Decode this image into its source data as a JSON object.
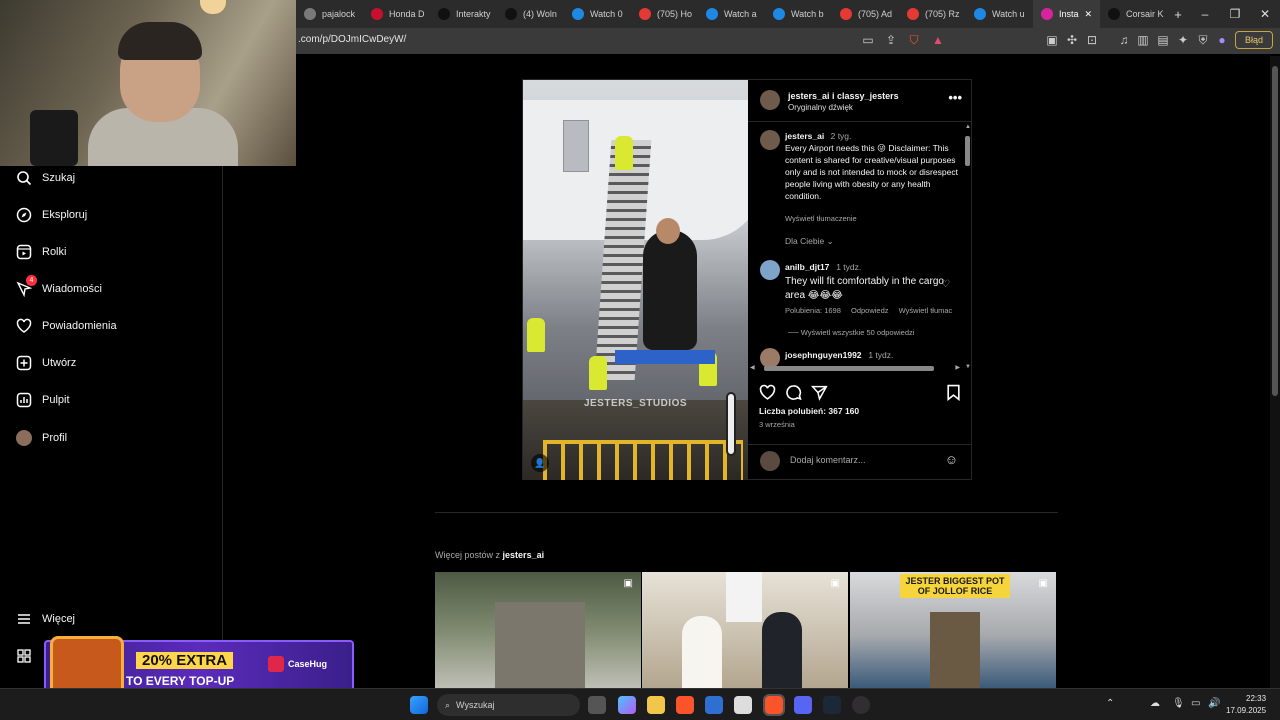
{
  "browser": {
    "tabs": [
      {
        "label": "pajalock",
        "color": "#7a7a7a"
      },
      {
        "label": "Honda D",
        "color": "#c8102e"
      },
      {
        "label": "Interakty",
        "color": "#111111"
      },
      {
        "label": "(4) Woln",
        "color": "#111111"
      },
      {
        "label": "Watch 0",
        "color": "#1e88e5"
      },
      {
        "label": "(705) Ho",
        "color": "#e53935"
      },
      {
        "label": "Watch a",
        "color": "#1e88e5"
      },
      {
        "label": "Watch b",
        "color": "#1e88e5"
      },
      {
        "label": "(705) Ad",
        "color": "#e53935"
      },
      {
        "label": "(705) Rz",
        "color": "#e53935"
      },
      {
        "label": "Watch u",
        "color": "#1e88e5"
      },
      {
        "label": "Insta",
        "color": "#d6249f",
        "active": true
      },
      {
        "label": "Corsair K",
        "color": "#111111"
      }
    ],
    "url": ".com/p/DOJmICwDeyW/",
    "error_label": "Błąd"
  },
  "sidebar": {
    "items": [
      {
        "label": "Szukaj",
        "icon": "search-icon"
      },
      {
        "label": "Eksploruj",
        "icon": "compass-icon"
      },
      {
        "label": "Rolki",
        "icon": "reels-icon"
      },
      {
        "label": "Wiadomości",
        "icon": "messenger-icon",
        "badge": "4"
      },
      {
        "label": "Powiadomienia",
        "icon": "heart-icon"
      },
      {
        "label": "Utwórz",
        "icon": "plus-square-icon"
      },
      {
        "label": "Pulpit",
        "icon": "dashboard-icon"
      },
      {
        "label": "Profil",
        "icon": "avatar"
      }
    ],
    "more": "Więcej"
  },
  "post": {
    "header": {
      "authors": "jesters_ai i classy_jesters",
      "audio": "Oryginalny dźwięk"
    },
    "watermark": "JESTERS_STUDIOS",
    "caption": {
      "user": "jesters_ai",
      "time": "2 tyg.",
      "text": "Every Airport needs this 😜 Disclaimer: This content is shared for creative/visual purposes only and is not intended to mock or disrespect people living with obesity or any health condition.",
      "translate": "Wyświetl tłumaczenie"
    },
    "for_you": "Dla Ciebie",
    "comments": [
      {
        "user": "anilb_djt17",
        "time": "1 tydz.",
        "text": "They will fit comfortably in the cargo area 😂😂😂",
        "likes": "Polubienia: 1698",
        "reply": "Odpowiedz",
        "translate": "Wyświetl tłumac",
        "view_replies": "Wyświetl wszystkie 50 odpowiedzi"
      },
      {
        "user": "josephnguyen1992",
        "time": "1 tydz."
      }
    ],
    "likes": "Liczba polubień: 367 160",
    "date": "3 września",
    "add_comment_placeholder": "Dodaj komentarz..."
  },
  "more_posts": {
    "prefix": "Więcej postów z",
    "user": "jesters_ai",
    "thumbs": [
      {
        "subject": "tropical building with palms"
      },
      {
        "subject": "wedding couple"
      },
      {
        "subject": "Jester Biggest Pot of Jollof Rice",
        "text": "JESTER BIGGEST POT OF JOLLOF RICE"
      }
    ]
  },
  "ad": {
    "line1": "20% EXTRA",
    "line2": "TO EVERY TOP-UP",
    "brand": "CaseHug"
  },
  "taskbar": {
    "search_placeholder": "Wyszukaj",
    "time": "22:33",
    "date": "17.09.2025"
  }
}
